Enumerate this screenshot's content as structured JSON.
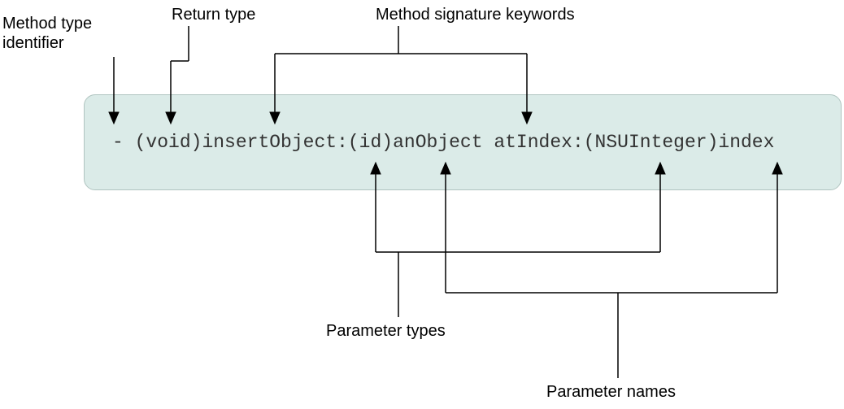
{
  "labels": {
    "method_type_identifier": "Method type\nidentifier",
    "return_type": "Return type",
    "method_signature_keywords": "Method signature keywords",
    "parameter_types": "Parameter types",
    "parameter_names": "Parameter names"
  },
  "code": {
    "minus": "- ",
    "void": "(void)",
    "insertObject": "insertObject:",
    "id": "(id)",
    "anObject": "anObject",
    "space": " ",
    "atIndex": "atIndex:",
    "nsuinteger": "(NSUInteger)",
    "index": "index"
  }
}
